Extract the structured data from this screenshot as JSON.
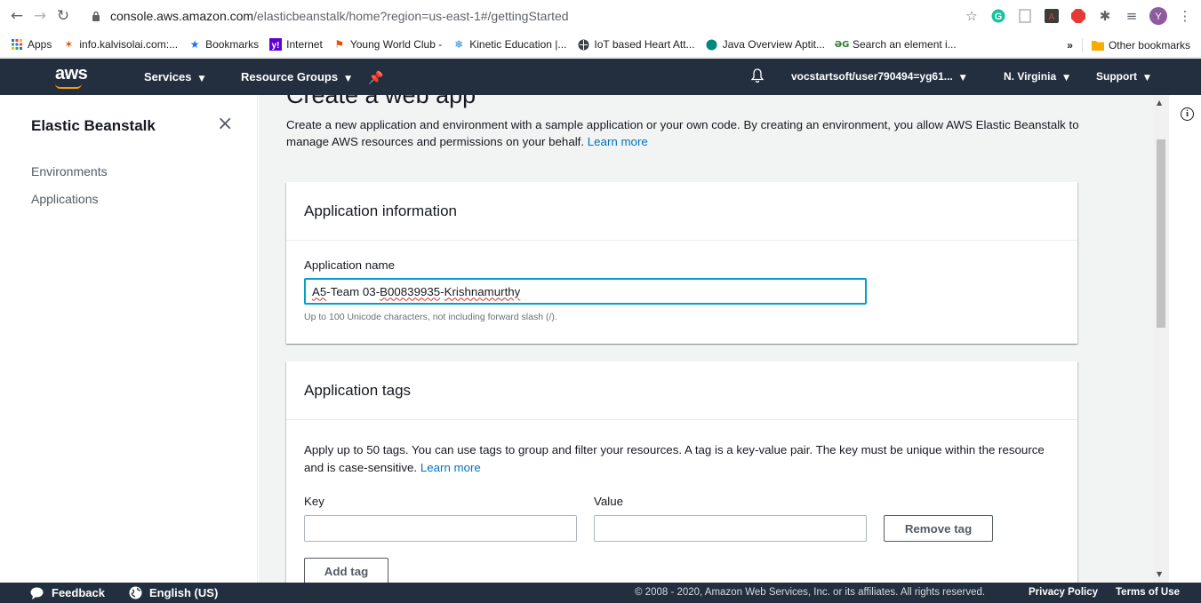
{
  "browser": {
    "url_host": "console.aws.amazon.com",
    "url_path": "/elasticbeanstalk/home?region=us-east-1#/gettingStarted",
    "profile_initial": "Y",
    "bookmarks": [
      {
        "label": "Apps",
        "icon": "apps-grid-icon"
      },
      {
        "label": "info.kalvisolai.com:...",
        "icon": "star-burst-icon"
      },
      {
        "label": "Bookmarks",
        "icon": "blue-star-icon"
      },
      {
        "label": "Internet",
        "icon": "yahoo-icon"
      },
      {
        "label": "Young World Club -",
        "icon": "ywc-icon"
      },
      {
        "label": "Kinetic Education |...",
        "icon": "snowflake-icon"
      },
      {
        "label": "IoT based Heart Att...",
        "icon": "globe-icon"
      },
      {
        "label": "Java Overview Aptit...",
        "icon": "java-icon"
      },
      {
        "label": "Search an element i...",
        "icon": "gfg-icon"
      }
    ],
    "overflow_label": "»",
    "other_bookmarks": "Other bookmarks"
  },
  "aws_nav": {
    "logo": "aws",
    "services": "Services",
    "resource_groups": "Resource Groups",
    "account": "vocstartsoft/user790494=yg61...",
    "region": "N. Virginia",
    "support": "Support"
  },
  "sidebar": {
    "title": "Elastic Beanstalk",
    "items": [
      {
        "label": "Environments"
      },
      {
        "label": "Applications"
      }
    ]
  },
  "main": {
    "title": "Create a web app",
    "description": "Create a new application and environment with a sample application or your own code. By creating an environment, you allow AWS Elastic Beanstalk to manage AWS resources and permissions on your behalf.",
    "learn_more": "Learn more",
    "app_info": {
      "heading": "Application information",
      "name_label": "Application name",
      "name_value_parts": [
        "A5",
        "-Team 03-",
        "B00839935",
        "-",
        "Krishnamurthy"
      ],
      "hint": "Up to 100 Unicode characters, not including forward slash (/)."
    },
    "app_tags": {
      "heading": "Application tags",
      "description": "Apply up to 50 tags. You can use tags to group and filter your resources. A tag is a key-value pair. The key must be unique within the resource and is case-sensitive.",
      "learn_more": "Learn more",
      "key_label": "Key",
      "value_label": "Value",
      "key_value": "",
      "value_value": "",
      "remove_tag": "Remove tag",
      "add_tag": "Add tag"
    }
  },
  "footer": {
    "feedback": "Feedback",
    "language": "English (US)",
    "copyright": "© 2008 - 2020, Amazon Web Services, Inc. or its affiliates. All rights reserved.",
    "privacy": "Privacy Policy",
    "terms": "Terms of Use"
  },
  "colors": {
    "aws_nav_bg": "#232f3e",
    "aws_orange": "#ff9900",
    "link": "#0073bb",
    "focus": "#00a1c9"
  }
}
